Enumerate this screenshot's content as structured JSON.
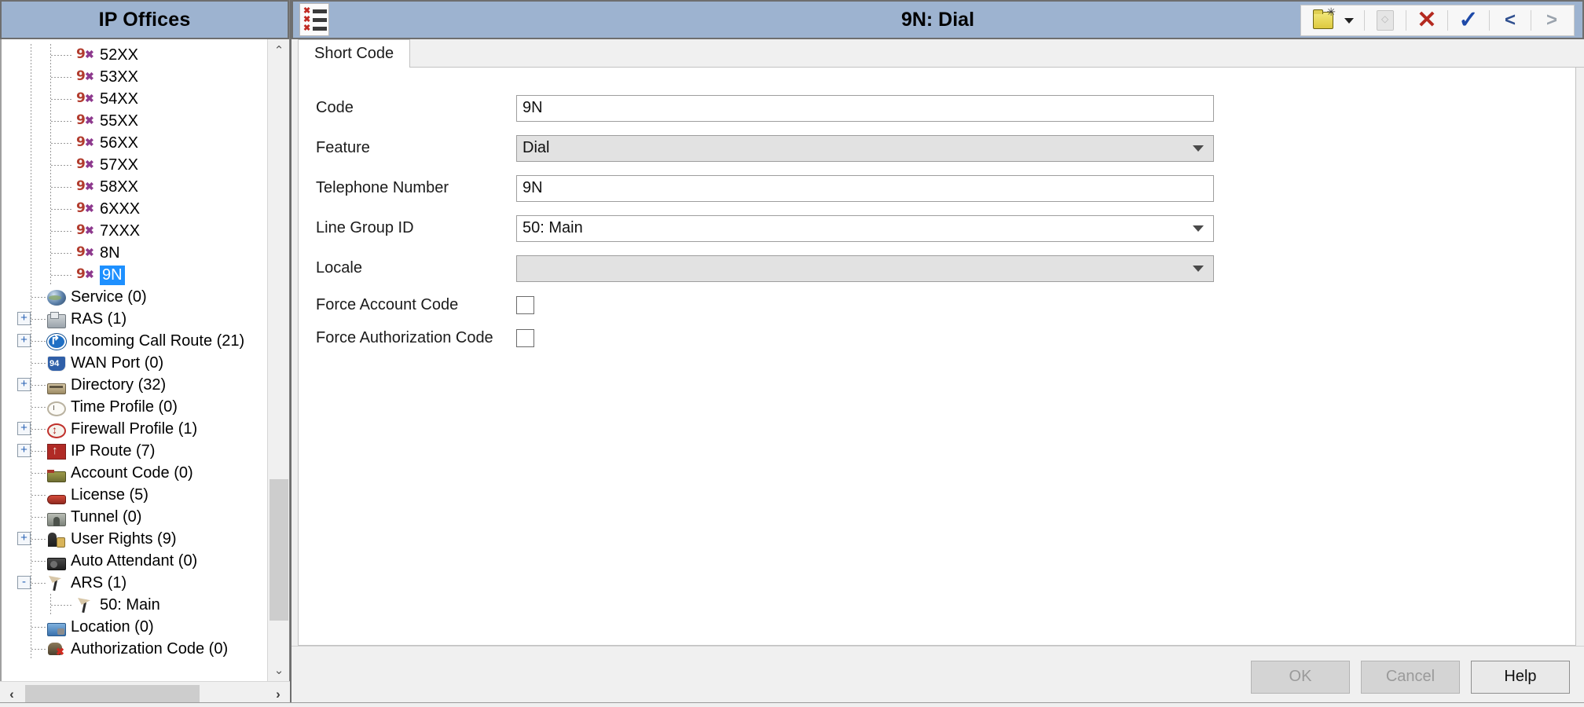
{
  "left_panel": {
    "header_title": "IP Offices",
    "tree_items": [
      {
        "label": "52XX",
        "icon": "shortcode-icon",
        "depth": 2,
        "expander": "",
        "selected": false
      },
      {
        "label": "53XX",
        "icon": "shortcode-icon",
        "depth": 2,
        "expander": "",
        "selected": false
      },
      {
        "label": "54XX",
        "icon": "shortcode-icon",
        "depth": 2,
        "expander": "",
        "selected": false
      },
      {
        "label": "55XX",
        "icon": "shortcode-icon",
        "depth": 2,
        "expander": "",
        "selected": false
      },
      {
        "label": "56XX",
        "icon": "shortcode-icon",
        "depth": 2,
        "expander": "",
        "selected": false
      },
      {
        "label": "57XX",
        "icon": "shortcode-icon",
        "depth": 2,
        "expander": "",
        "selected": false
      },
      {
        "label": "58XX",
        "icon": "shortcode-icon",
        "depth": 2,
        "expander": "",
        "selected": false
      },
      {
        "label": "6XXX",
        "icon": "shortcode-icon",
        "depth": 2,
        "expander": "",
        "selected": false
      },
      {
        "label": "7XXX",
        "icon": "shortcode-icon",
        "depth": 2,
        "expander": "",
        "selected": false
      },
      {
        "label": "8N",
        "icon": "shortcode-icon",
        "depth": 2,
        "expander": "",
        "selected": false
      },
      {
        "label": "9N",
        "icon": "shortcode-icon",
        "depth": 2,
        "expander": "",
        "selected": true
      },
      {
        "label": "Service (0)",
        "icon": "globe-icon",
        "depth": 1,
        "expander": "",
        "selected": false
      },
      {
        "label": "RAS (1)",
        "icon": "ras-icon",
        "depth": 1,
        "expander": "+",
        "selected": false
      },
      {
        "label": "Incoming Call Route (21)",
        "icon": "route-sign-icon",
        "depth": 1,
        "expander": "+",
        "selected": false
      },
      {
        "label": "WAN Port (0)",
        "icon": "wan-port-icon",
        "depth": 1,
        "expander": "",
        "selected": false
      },
      {
        "label": "Directory (32)",
        "icon": "directory-icon",
        "depth": 1,
        "expander": "+",
        "selected": false
      },
      {
        "label": "Time Profile (0)",
        "icon": "clock-icon",
        "depth": 1,
        "expander": "",
        "selected": false
      },
      {
        "label": "Firewall Profile (1)",
        "icon": "firewall-icon",
        "depth": 1,
        "expander": "+",
        "selected": false
      },
      {
        "label": "IP Route (7)",
        "icon": "ip-route-icon",
        "depth": 1,
        "expander": "+",
        "selected": false
      },
      {
        "label": "Account Code (0)",
        "icon": "account-code-icon",
        "depth": 1,
        "expander": "",
        "selected": false
      },
      {
        "label": "License (5)",
        "icon": "license-icon",
        "depth": 1,
        "expander": "",
        "selected": false
      },
      {
        "label": "Tunnel (0)",
        "icon": "tunnel-icon",
        "depth": 1,
        "expander": "",
        "selected": false
      },
      {
        "label": "User Rights (9)",
        "icon": "user-rights-icon",
        "depth": 1,
        "expander": "+",
        "selected": false
      },
      {
        "label": "Auto Attendant (0)",
        "icon": "auto-attendant-icon",
        "depth": 1,
        "expander": "",
        "selected": false
      },
      {
        "label": "ARS (1)",
        "icon": "ars-icon",
        "depth": 1,
        "expander": "-",
        "selected": false
      },
      {
        "label": "50: Main",
        "icon": "ars-icon",
        "depth": 2,
        "expander": "",
        "selected": false
      },
      {
        "label": "Location (0)",
        "icon": "location-icon",
        "depth": 1,
        "expander": "",
        "selected": false
      },
      {
        "label": "Authorization Code (0)",
        "icon": "authorization-code-icon",
        "depth": 1,
        "expander": "",
        "selected": false
      }
    ],
    "scroll_up_glyph": "⌃",
    "scroll_down_glyph": "⌄",
    "scroll_left_glyph": "‹",
    "scroll_right_glyph": "›"
  },
  "right_panel": {
    "title": "9N: Dial",
    "toolbar": {
      "new_label": "new-item",
      "dropdown_label": "new-item-dropdown",
      "duplicate_label": "duplicate",
      "delete_label": "delete",
      "validate_label": "validate",
      "previous_label": "<",
      "next_label": ">"
    },
    "tabs": [
      {
        "label": "Short Code",
        "active": true
      }
    ],
    "form": {
      "code": {
        "label": "Code",
        "value": "9N"
      },
      "feature": {
        "label": "Feature",
        "value": "Dial",
        "disabled": true
      },
      "telephone_number": {
        "label": "Telephone Number",
        "value": "9N"
      },
      "line_group_id": {
        "label": "Line Group ID",
        "value": "50: Main",
        "disabled": false
      },
      "locale": {
        "label": "Locale",
        "value": "",
        "disabled": true
      },
      "force_account_code": {
        "label": "Force Account Code",
        "checked": false
      },
      "force_authorization_code": {
        "label": "Force Authorization Code",
        "checked": false
      }
    },
    "footer": {
      "ok_label": "OK",
      "cancel_label": "Cancel",
      "help_label": "Help"
    }
  },
  "colors": {
    "titlebar": "#9db3d0",
    "selection": "#1e90ff",
    "delete_red": "#b42a20",
    "check_blue": "#1d49a8"
  }
}
